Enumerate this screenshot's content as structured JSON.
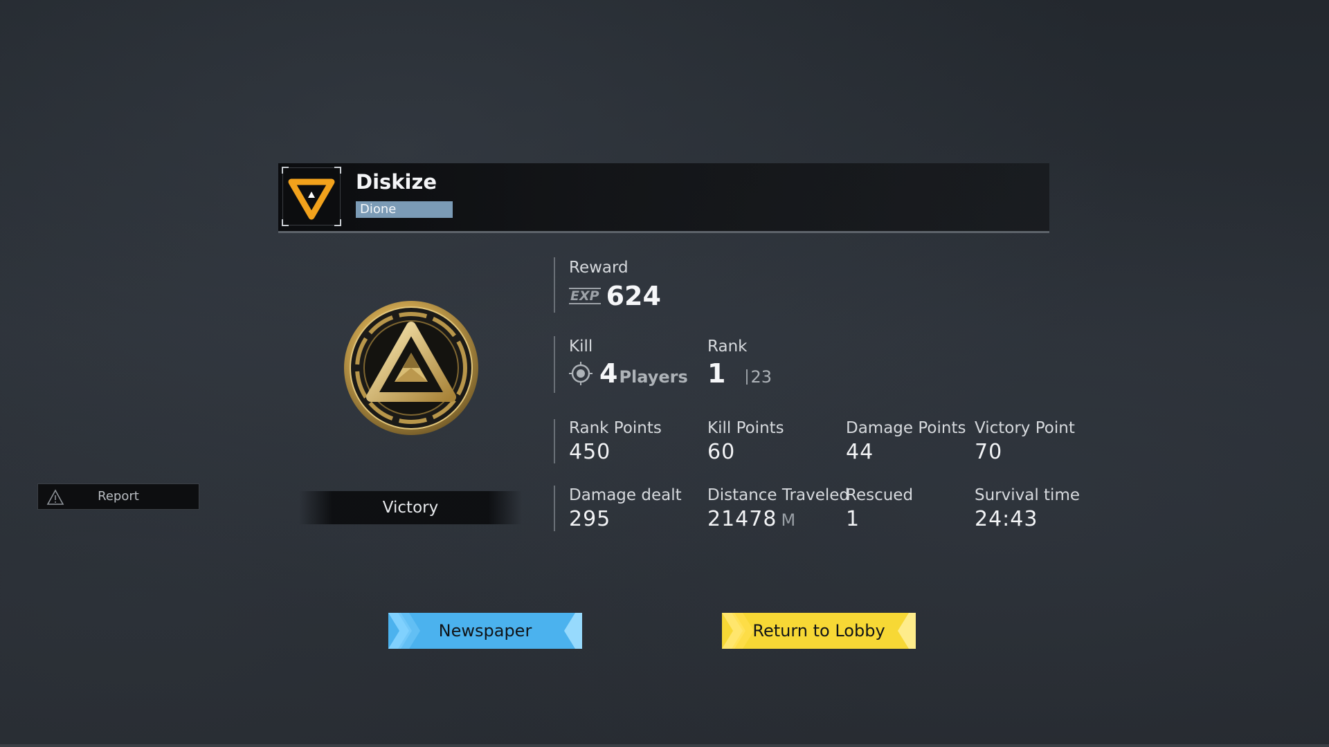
{
  "player": {
    "name": "Diskize",
    "server": "Dione",
    "avatar_icon": "orange-triangle-emblem-icon"
  },
  "result": {
    "label": "Victory",
    "medal_icon": "gold-triangle-medal-icon"
  },
  "report": {
    "label": "Report",
    "icon": "warning-triangle-icon"
  },
  "reward": {
    "label": "Reward",
    "currency": "EXP",
    "value": "624"
  },
  "kill": {
    "label": "Kill",
    "value": "4",
    "unit": "Players",
    "icon": "crosshair-icon"
  },
  "rank": {
    "label": "Rank",
    "value": "1",
    "total": "23"
  },
  "stats_row1": [
    {
      "label": "Rank Points",
      "value": "450"
    },
    {
      "label": "Kill Points",
      "value": "60"
    },
    {
      "label": "Damage Points",
      "value": "44"
    },
    {
      "label": "Victory Point",
      "value": "70"
    }
  ],
  "stats_row2": [
    {
      "label": "Damage dealt",
      "value": "295",
      "unit": ""
    },
    {
      "label": "Distance Traveled",
      "value": "21478",
      "unit": "M"
    },
    {
      "label": "Rescued",
      "value": "1",
      "unit": ""
    },
    {
      "label": "Survival time",
      "value": "24:43",
      "unit": ""
    }
  ],
  "buttons": {
    "newspaper": "Newspaper",
    "lobby": "Return to Lobby"
  },
  "colors": {
    "newspaper_button": "#4bb2ee",
    "lobby_button": "#f7d835",
    "avatar_accent": "#f2a21c",
    "server_tag": "#7b9bb6",
    "medal_gold": "#d4b25a"
  }
}
